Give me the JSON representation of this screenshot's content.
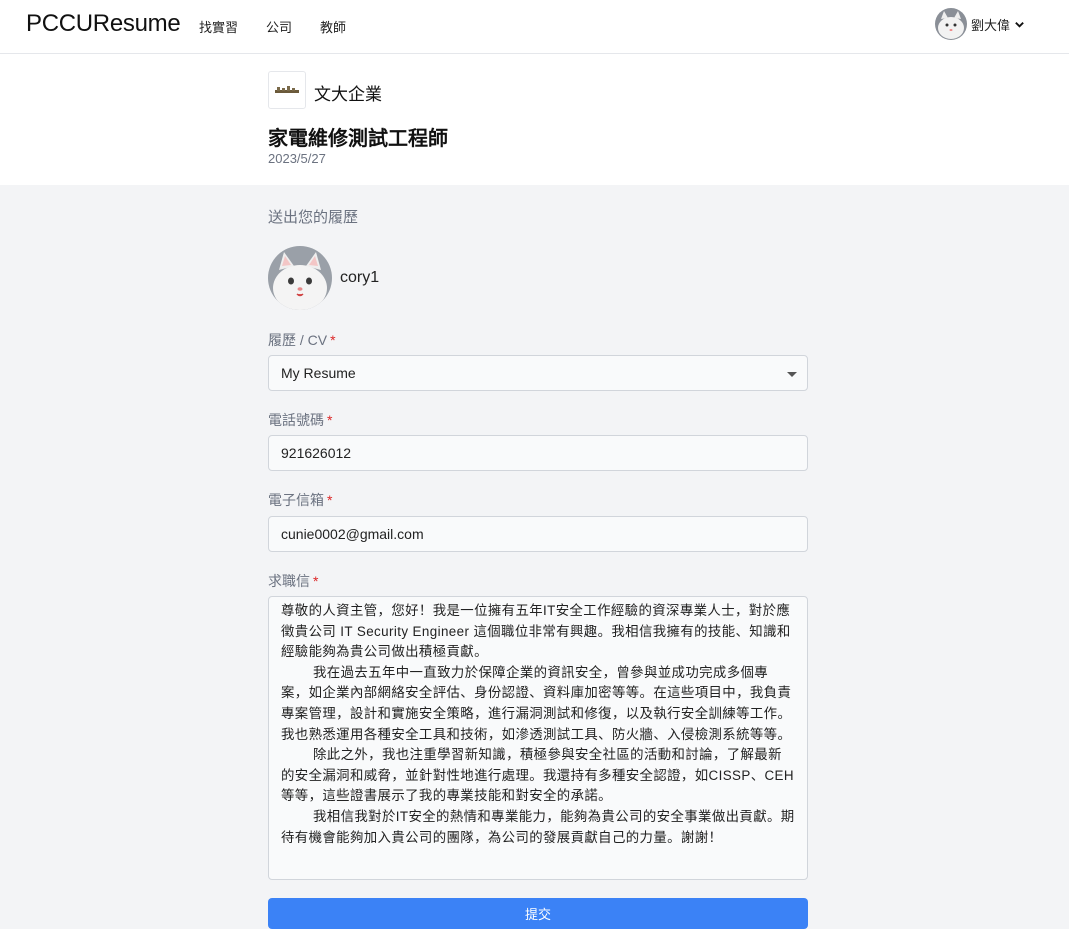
{
  "nav": {
    "brand": "PCCUResume",
    "links": [
      "找實習",
      "公司",
      "教師"
    ],
    "user_name": "劉大偉"
  },
  "job": {
    "company": "文大企業",
    "title": "家電維修測試工程師",
    "date": "2023/5/27"
  },
  "form": {
    "section_title": "送出您的履歷",
    "profile_name": "cory1",
    "resume_label": "履歷 / CV",
    "resume_value": "My Resume",
    "phone_label": "電話號碼",
    "phone_value": "921626012",
    "email_label": "電子信箱",
    "email_value": "cunie0002@gmail.com",
    "letter_label": "求職信",
    "required_mark": "*",
    "letter_paragraphs": [
      "尊敬的人資主管，您好！我是一位擁有五年IT安全工作經驗的資深專業人士，對於應徵貴公司 IT Security Engineer 這個職位非常有興趣。我相信我擁有的技能、知識和經驗能夠為貴公司做出積極貢獻。",
      "我在過去五年中一直致力於保障企業的資訊安全，曾參與並成功完成多個專案，如企業內部網絡安全評估、身份認證、資料庫加密等等。在這些項目中，我負責專案管理，設計和實施安全策略，進行漏洞測試和修復，以及執行安全訓練等工作。我也熟悉運用各種安全工具和技術，如滲透測試工具、防火牆、入侵檢測系統等等。",
      "除此之外，我也注重學習新知識，積極參與安全社區的活動和討論，了解最新的安全漏洞和威脅，並針對性地進行處理。我還持有多種安全認證，如CISSP、CEH等等，這些證書展示了我的專業技能和對安全的承諾。",
      "我相信我對於IT安全的熱情和專業能力，能夠為貴公司的安全事業做出貢獻。期待有機會能夠加入貴公司的團隊，為公司的發展貢獻自己的力量。謝謝！"
    ],
    "submit_label": "提交"
  },
  "colors": {
    "primary": "#3b82f6",
    "required": "#dc2626",
    "page_bg": "#f3f4f6"
  },
  "icons": {
    "user_menu": "chevron-down-icon",
    "select": "caret-down-icon"
  }
}
